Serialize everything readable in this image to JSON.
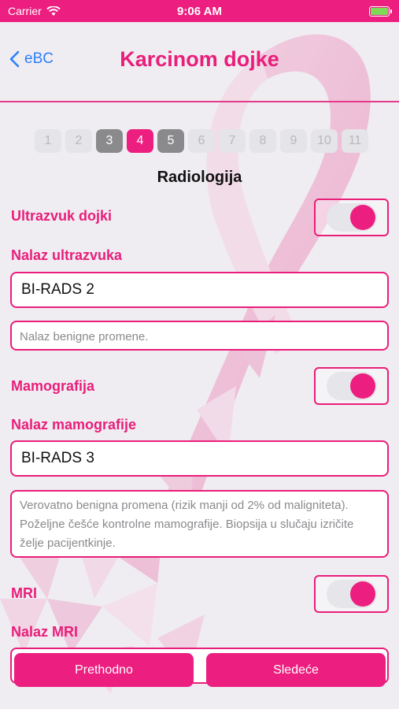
{
  "status_bar": {
    "carrier": "Carrier",
    "time": "9:06 AM"
  },
  "nav": {
    "back_label": "eBC",
    "title": "Karcinom dojke"
  },
  "pager": {
    "pages": [
      "1",
      "2",
      "3",
      "4",
      "5",
      "6",
      "7",
      "8",
      "9",
      "10",
      "11"
    ],
    "visited": [
      "3",
      "5"
    ],
    "active": "4"
  },
  "section_title": "Radiologija",
  "ultrazvuk": {
    "label": "Ultrazvuk dojki",
    "toggle_on": true,
    "result_label": "Nalaz ultrazvuka",
    "result_value": "BI-RADS 2",
    "description": "Nalaz benigne promene."
  },
  "mamografija": {
    "label": "Mamografija",
    "toggle_on": true,
    "result_label": "Nalaz mamografije",
    "result_value": "BI-RADS 3",
    "description": "Verovatno benigna promena (rizik manji od 2% od maligniteta). Poželjne češće kontrolne mamografije. Biopsija u slučaju izričite želje pacijentkinje."
  },
  "mri": {
    "label": "MRI",
    "toggle_on": true,
    "result_label": "Nalaz MRI"
  },
  "buttons": {
    "previous": "Prethodno",
    "next": "Sledeće"
  },
  "colors": {
    "accent": "#ec1e7f",
    "back_link": "#2d7ff9",
    "background": "#efedf2"
  }
}
